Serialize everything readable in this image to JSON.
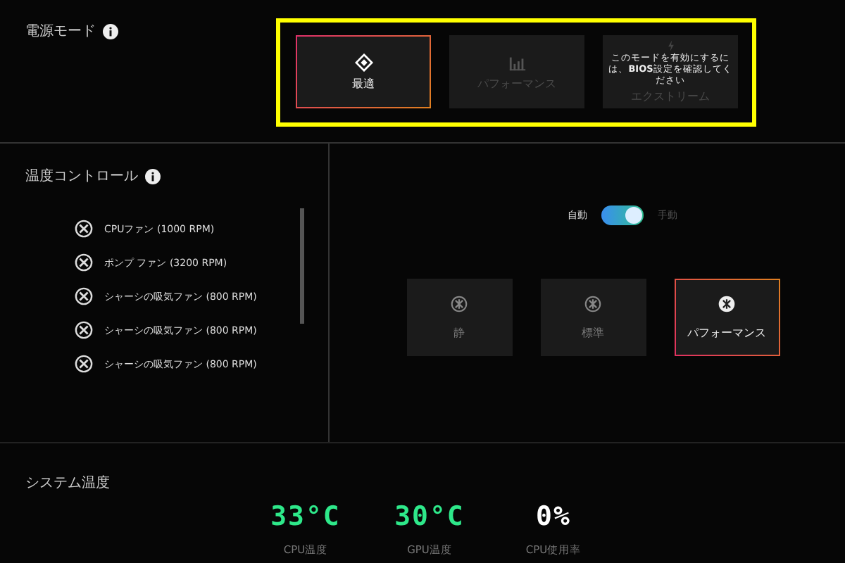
{
  "power_mode": {
    "title": "電源モード",
    "modes": [
      {
        "label": "最適",
        "selected": true,
        "disabled": false
      },
      {
        "label": "パフォーマンス",
        "selected": false,
        "disabled": true
      },
      {
        "label": "エクストリーム",
        "selected": false,
        "disabled": true,
        "note": "このモードを有効にするには、**BIOS**設定を確認してください"
      }
    ]
  },
  "temperature_control": {
    "title": "温度コントロール",
    "fans": [
      {
        "name": "CPUファン (1000 RPM)"
      },
      {
        "name": "ポンプ ファン (3200 RPM)"
      },
      {
        "name": "シャーシの吸気ファン (800 RPM)"
      },
      {
        "name": "シャーシの吸気ファン (800 RPM)"
      },
      {
        "name": "シャーシの吸気ファン (800 RPM)"
      }
    ],
    "toggle": {
      "left_label": "自動",
      "right_label": "手動",
      "on": true
    },
    "fan_modes": [
      {
        "label": "静",
        "selected": false
      },
      {
        "label": "標準",
        "selected": false
      },
      {
        "label": "パフォーマンス",
        "selected": true
      }
    ]
  },
  "system_temperature": {
    "title": "システム温度",
    "readings": [
      {
        "value": "33°C",
        "label": "CPU温度",
        "color": "#2ee88a"
      },
      {
        "value": "30°C",
        "label": "GPU温度",
        "color": "#2ee88a"
      },
      {
        "value": "0%",
        "label": "CPU使用率",
        "color": "#ffffff"
      }
    ]
  }
}
